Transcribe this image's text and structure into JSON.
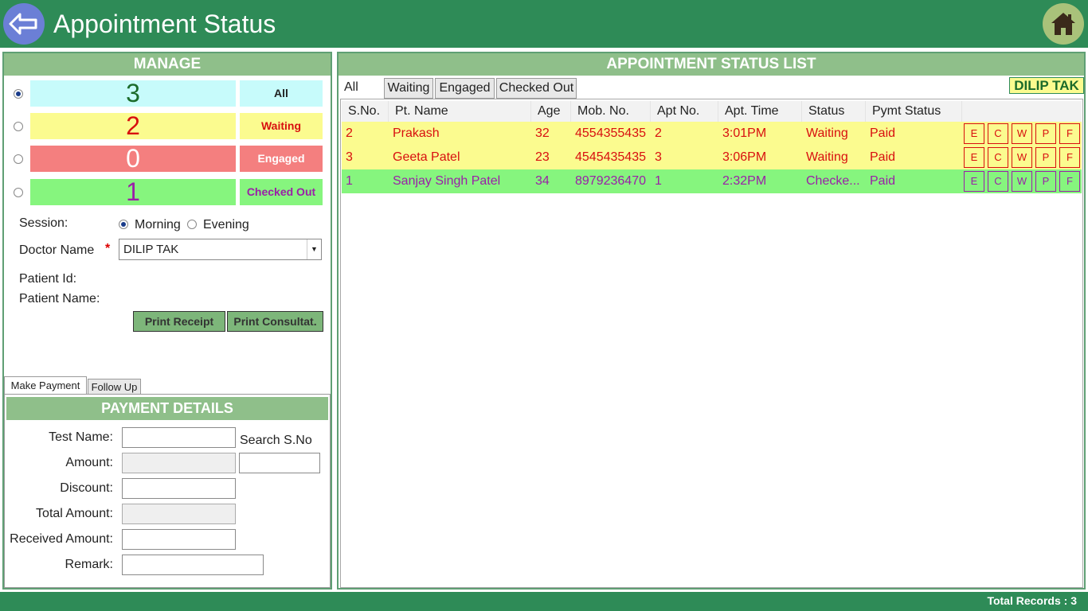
{
  "title": "Appointment Status",
  "manage": {
    "heading": "MANAGE",
    "counters": [
      {
        "count": "3",
        "label": "All",
        "count_color": "#1b6b2a",
        "box_bg": "#c7fbfb",
        "label_bg": "#c7fbfb",
        "label_color": "#222222",
        "checked": true
      },
      {
        "count": "2",
        "label": "Waiting",
        "count_color": "#d80f0f",
        "box_bg": "#fbfb8f",
        "label_bg": "#fbfb8f",
        "label_color": "#d80f0f",
        "checked": false
      },
      {
        "count": "0",
        "label": "Engaged",
        "count_color": "#ffffff",
        "box_bg": "#f47f7f",
        "label_bg": "#f47f7f",
        "label_color": "#ffffff",
        "checked": false
      },
      {
        "count": "1",
        "label": "Checked Out",
        "count_color": "#9b1fa8",
        "box_bg": "#86f57e",
        "label_bg": "#86f57e",
        "label_color": "#9b1fa8",
        "checked": false
      }
    ],
    "session_label": "Session:",
    "session_options": [
      "Morning",
      "Evening"
    ],
    "session_selected": "Morning",
    "doctor_label": "Doctor Name",
    "required_mark": "*",
    "doctor_value": "DILIP TAK",
    "patient_id_label": "Patient Id:",
    "patient_name_label": "Patient Name:",
    "print_receipt": "Print Receipt",
    "print_consultation": "Print Consultat."
  },
  "payment": {
    "tabs": [
      "Make Payment",
      "Follow Up"
    ],
    "active_tab": "Make Payment",
    "heading": "PAYMENT DETAILS",
    "test_name_label": "Test Name:",
    "search_label": "Search S.No",
    "amount_label": "Amount:",
    "discount_label": "Discount:",
    "total_amount_label": "Total Amount:",
    "received_amount_label": "Received Amount:",
    "remark_label": "Remark:"
  },
  "list": {
    "heading": "APPOINTMENT STATUS LIST",
    "tabs": [
      "All",
      "Waiting",
      "Engaged",
      "Checked Out"
    ],
    "active_tab": "All",
    "doctor_badge": "DILIP TAK",
    "columns": [
      "S.No.",
      "Pt. Name",
      "Age",
      "Mob. No.",
      "Apt No.",
      "Apt. Time",
      "Status",
      "Pymt Status"
    ],
    "action_labels": [
      "E",
      "C",
      "W",
      "P",
      "F"
    ],
    "rows": [
      {
        "sno": "2",
        "name": "Prakash",
        "age": "32",
        "mobile": "4554355435",
        "apt_no": "2",
        "time": "3:01PM",
        "status": "Waiting",
        "pymt": "Paid",
        "bg": "#fbfb8f",
        "fg": "#d80f0f"
      },
      {
        "sno": "3",
        "name": "Geeta Patel",
        "age": "23",
        "mobile": "4545435435",
        "apt_no": "3",
        "time": "3:06PM",
        "status": "Waiting",
        "pymt": "Paid",
        "bg": "#fbfb8f",
        "fg": "#d80f0f"
      },
      {
        "sno": "1",
        "name": "Sanjay Singh Patel",
        "age": "34",
        "mobile": "8979236470",
        "apt_no": "1",
        "time": "2:32PM",
        "status": "Checke...",
        "pymt": "Paid",
        "bg": "#86f57e",
        "fg": "#9b1fa8"
      }
    ]
  },
  "footer": {
    "total_records": "Total Records : 3"
  },
  "colors": {
    "brand": "#2e8b57",
    "panel_head": "#8fbf8a"
  },
  "icons": {
    "back": "back-arrow-icon",
    "home": "home-icon"
  }
}
